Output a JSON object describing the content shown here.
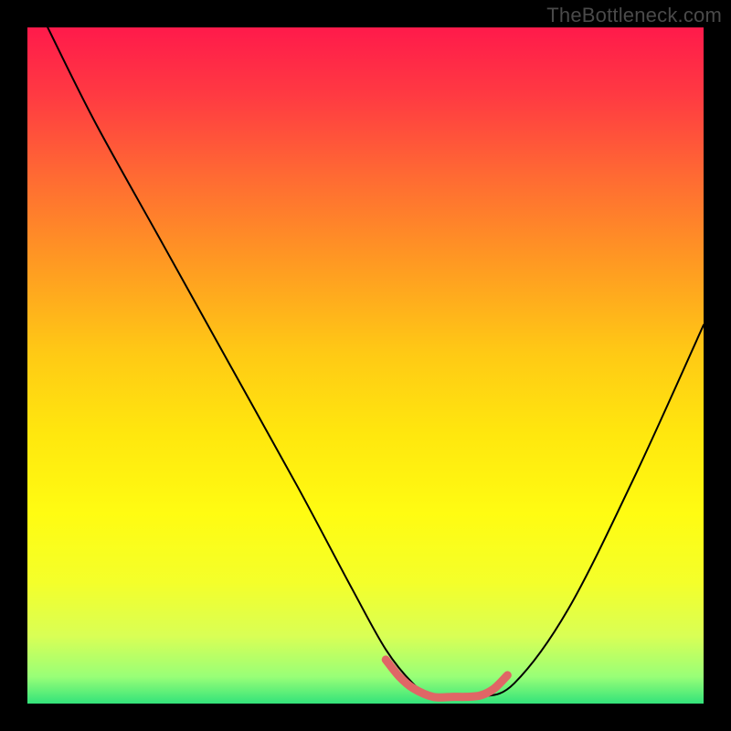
{
  "watermark": "TheBottleneck.com",
  "gradient_stops": [
    {
      "offset": 0.0,
      "color": "#ff1a4b"
    },
    {
      "offset": 0.1,
      "color": "#ff3a42"
    },
    {
      "offset": 0.22,
      "color": "#ff6a33"
    },
    {
      "offset": 0.35,
      "color": "#ff9a22"
    },
    {
      "offset": 0.48,
      "color": "#ffc915"
    },
    {
      "offset": 0.6,
      "color": "#ffe70e"
    },
    {
      "offset": 0.72,
      "color": "#fffc12"
    },
    {
      "offset": 0.82,
      "color": "#f4ff2a"
    },
    {
      "offset": 0.9,
      "color": "#d9ff55"
    },
    {
      "offset": 0.96,
      "color": "#99ff77"
    },
    {
      "offset": 1.0,
      "color": "#33e37a"
    }
  ],
  "chart_data": {
    "type": "line",
    "title": "",
    "xlabel": "",
    "ylabel": "",
    "xlim": [
      0,
      100
    ],
    "ylim": [
      0,
      100
    ],
    "series": [
      {
        "name": "bottleneck-curve",
        "stroke": "#000000",
        "stroke_width": 2,
        "x": [
          3,
          10,
          20,
          30,
          40,
          48,
          53,
          57,
          60,
          63,
          67,
          72,
          80,
          90,
          100
        ],
        "y": [
          100,
          86,
          68,
          50,
          32,
          17,
          8,
          3,
          1,
          1,
          1,
          3,
          14,
          34,
          56
        ]
      },
      {
        "name": "optimal-band-marker",
        "stroke": "#e06666",
        "stroke_width": 9,
        "linecap": "round",
        "linejoin": "round",
        "x": [
          53,
          55,
          57,
          60,
          63,
          65,
          67,
          69,
          71
        ],
        "y": [
          6.5,
          4.0,
          2.3,
          1.0,
          1.0,
          1.0,
          1.2,
          2.2,
          4.2
        ]
      }
    ]
  }
}
